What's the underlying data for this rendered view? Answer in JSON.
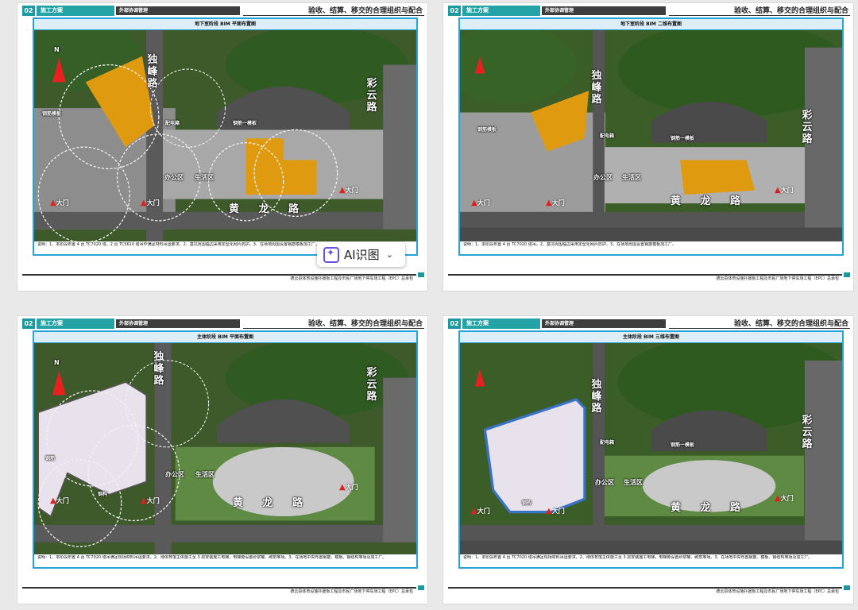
{
  "header": {
    "num": "02",
    "section": "施工方案",
    "subsection": "外部协调管理",
    "right_title": "验收、结算、移交的合理组织与配合"
  },
  "footer": {
    "text": "德云县体育设施扑援板工程及市民广场地下停车场工程（EPC）总承包"
  },
  "pages": [
    {
      "title": "地下室阶段 BIM 平面布置图",
      "note": "说明：1、本阶段布置 4 台 TC7020 塔，2 台 TC5610 塔吊作满足材料吊运要求。2、基坑周围临边采用定型化网片防护。3、在场地周围设置钢筋模板加工厂。",
      "labels": {
        "road_north": "独峰路",
        "road_east": "彩云路",
        "road_south": "黄 龙 路",
        "office": "办公区",
        "living": "生活区",
        "gate": "大门",
        "power": "配电箱",
        "steel": "钢筋一模板",
        "steel2": "钢筋模板"
      }
    },
    {
      "title": "地下室阶段 BIM 二维布置图",
      "note": "说明：1、本阶段布置 4 台 TC7020 塔吊。2、基坑周围临边采用定型化网片防护。3、在场地周围设置钢筋模板加工厂。",
      "labels": {
        "road_north": "独峰路",
        "road_east": "彩云路",
        "road_south": "黄 龙 路",
        "office": "办公区",
        "living": "生活区",
        "gate": "大门",
        "power": "配电箱",
        "steel": "钢筋一模板",
        "steel2": "钢筋模板"
      }
    },
    {
      "title": "主体阶段 BIM 平面布置图",
      "note": "说明：1、本阶段布置 4 台 TC7020 塔吊满足现场材料吊运要求。2、待体育馆主体施工至 3 层安装施工电梯，电梯旁设置砂浆罐、砌筑堆场。3、在场地中央布置钢筋、模板、钢结构堆场及加工厂。",
      "labels": {
        "road_north": "独峰路",
        "road_east": "彩云路",
        "road_south": "黄 龙 路",
        "office": "办公区",
        "living": "生活区",
        "gate": "大门",
        "steel": "钢筋",
        "steel2": "钢构"
      }
    },
    {
      "title": "主体阶段 BIM 三维布置图",
      "note": "说明：1、本阶段布置 4 台 TC7020 塔吊满足现场材料吊运要求。2、待体育馆主体施工至 3 层安装施工电梯，电梯旁设置砂浆罐、砌筑堆场。3、在场地中央布置钢筋、模板、钢结构堆场及加工厂。",
      "labels": {
        "road_north": "独峰路",
        "road_east": "彩云路",
        "road_south": "黄 龙 路",
        "office": "办公区",
        "living": "生活区",
        "gate": "大门",
        "power": "配电箱",
        "steel": "钢筋一模板",
        "steel2": "钢构"
      }
    }
  ],
  "ai_button": {
    "label": "AI识图",
    "icon": "ai-sparkle-icon",
    "chevron": "chevron-down-icon"
  },
  "colors": {
    "teal": "#23a3a6",
    "frame_blue": "#26a4d8",
    "orange_area": "#e09a10",
    "gate_arrow": "#e02020"
  }
}
